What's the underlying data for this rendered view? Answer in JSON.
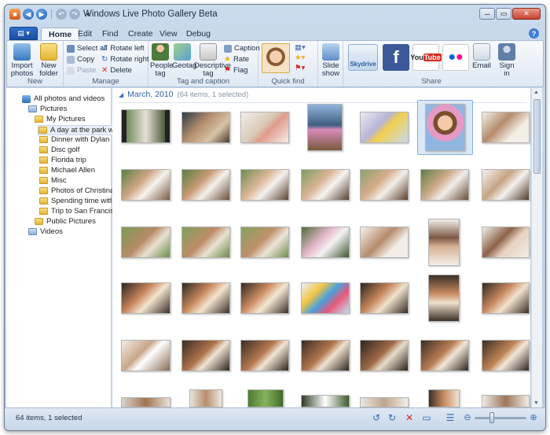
{
  "window": {
    "title": "Windows Live Photo Gallery Beta"
  },
  "tabs": [
    "Home",
    "Edit",
    "Find",
    "Create",
    "View",
    "Debug"
  ],
  "ribbon": {
    "new": {
      "import_label": "Import photos",
      "new_folder_label": "New folder",
      "group_label": "New"
    },
    "manage": {
      "select_all": "Select all",
      "copy": "Copy",
      "paste": "Paste",
      "rotate_left": "Rotate left",
      "rotate_right": "Rotate right",
      "delete": "Delete",
      "group_label": "Manage"
    },
    "tag_caption": {
      "people_tag": "People tag",
      "geotag": "Geotag",
      "descriptive_tag": "Descriptive tag",
      "caption": "Caption",
      "rate": "Rate",
      "flag": "Flag",
      "group_label": "Tag and caption"
    },
    "quick_find": {
      "group_label": "Quick find"
    },
    "slideshow_label": "Slide show",
    "share": {
      "skydrive": "Skydrive",
      "email": "Email",
      "sign_in": "Sign in",
      "group_label": "Share"
    }
  },
  "tree": {
    "items": [
      {
        "label": "All photos and videos",
        "level": 0,
        "icon": "library"
      },
      {
        "label": "Pictures",
        "level": 1,
        "icon": "folder-blue"
      },
      {
        "label": "My Pictures",
        "level": 2,
        "icon": "folder"
      },
      {
        "label": "A day at the park with D",
        "level": 3,
        "icon": "folder",
        "selected": true
      },
      {
        "label": "Dinner with Dylan",
        "level": 3,
        "icon": "folder"
      },
      {
        "label": "Disc golf",
        "level": 3,
        "icon": "folder"
      },
      {
        "label": "Florida trip",
        "level": 3,
        "icon": "folder"
      },
      {
        "label": "Michael Allen",
        "level": 3,
        "icon": "folder"
      },
      {
        "label": "Misc",
        "level": 3,
        "icon": "folder"
      },
      {
        "label": "Photos of Christina",
        "level": 3,
        "icon": "folder"
      },
      {
        "label": "Spending time with the",
        "level": 3,
        "icon": "folder"
      },
      {
        "label": "Trip to San Francisco",
        "level": 3,
        "icon": "folder"
      },
      {
        "label": "Public Pictures",
        "level": 2,
        "icon": "folder"
      },
      {
        "label": "Videos",
        "level": 1,
        "icon": "folder-blue"
      }
    ]
  },
  "gallery": {
    "month": "March, 2010",
    "count": "(64 items, 1 selected)"
  },
  "status": {
    "text": "64 items, 1 selected"
  },
  "colors": {
    "accent": "#2f62ad",
    "selection": "#dbe8f7"
  }
}
